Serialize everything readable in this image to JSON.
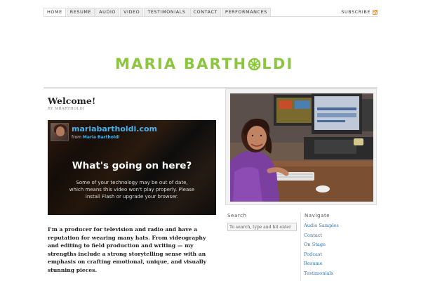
{
  "nav": {
    "items": [
      {
        "label": "Home",
        "active": true
      },
      {
        "label": "Resume"
      },
      {
        "label": "Audio"
      },
      {
        "label": "Video"
      },
      {
        "label": "Testimonials"
      },
      {
        "label": "Contact"
      },
      {
        "label": "Performances"
      }
    ],
    "subscribe_label": "Subscribe",
    "subscribe_icon": "rss-icon"
  },
  "header": {
    "logo_text_left": "MARIA BARTH",
    "logo_text_right": "LDI",
    "logo_color": "#8cc63f"
  },
  "post": {
    "title": "Welcome!",
    "byline": "by MBARTHOLDI",
    "video": {
      "site": "mariabartholdi.com",
      "from_prefix": "from ",
      "from_name": "Maria Bartholdi",
      "headline": "What's going on here?",
      "message": "Some of your technology may be out of date, which means this video won't play properly. Please install Flash or upgrade your browser."
    },
    "intro": "I'm a producer for television and radio and have a reputation for wearing many hats. From videography and editing to field production and writing — my strengths include a strong storytelling sense with an emphasis on crafting emotional, unique, and visually stunning pieces."
  },
  "sidebar": {
    "search": {
      "title": "Search",
      "placeholder": "To search, type and hit enter"
    },
    "navigate": {
      "title": "Navigate",
      "items": [
        "Audio Samples",
        "Contact",
        "On Stage",
        "Podcast",
        "Resume",
        "Testimonials"
      ]
    }
  },
  "colors": {
    "accent_green": "#8cc63f",
    "link_blue": "#3370a8",
    "video_link": "#4ab0e8"
  }
}
